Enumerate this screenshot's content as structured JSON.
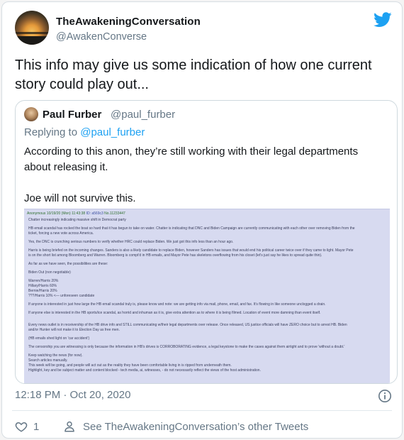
{
  "tweet": {
    "author_name": "TheAwakeningConversation",
    "author_handle": "@AwakenConverse",
    "text": "This info may give us some indication of how one current story could play out...",
    "timestamp": "12:18 PM · Oct 20, 2020",
    "like_count": "1",
    "see_other_tweets": "See TheAwakeningConversation’s other Tweets"
  },
  "quote": {
    "author_name": "Paul Furber",
    "author_handle": "@paul_furber",
    "replying_to_prefix": "Replying to ",
    "replying_to_handle": "@paul_furber",
    "body_p1": "According to this anon, they’re still working with their legal departments about releasing it.",
    "body_p2": "Joe will not survive this.",
    "image_header_name": "Anonymous",
    "image_header_date": "10/19/20 (Mon) 11:43:38",
    "image_header_id": "ID: a569c3",
    "image_header_no": "No.11233447",
    "image_lines": [
      "Chatter increasingly indicating massive shift in Democrat party",
      "",
      "HB email scandal has rocked the boat so hard that it has begun to take on water. Chatter is indicating that DNC and Biden Campaign are currently communicating with each other over removing Biden from the",
      "ticket, forcing a new vote across America.",
      "",
      "Yes, the DNC is crunching serious numbers to verify whether HRC could replace Biden. We just got this info less than an hour ago.",
      "",
      "Harris is being briefed on the incoming changes. Sanders is also a likely candidate to replace Biden, however Sanders has issues that would end his political career twice over if they came to light. Mayor Pete",
      "is on the short list among Bloomberg and Warren. Bloomberg is compt'd in HB emails, and Mayor Pete has skeletons overflowing from his closet (let's just say he likes to spread quite thin).",
      "",
      "As far as we have seen, the possibilities are these:",
      "",
      "Biden Out (non negotiable)",
      "",
      "Warren/Harris 20%",
      "Hillary/Harris 60%",
      "Bernie/Harris 20%",
      "???/Harris 10% <— unforeseen candidate",
      "",
      "If anyone is interested in just how large the HB email scandal truly is, please know and note: we are getting info via mail, phone, email, and fax. It's flowing in like someone unclogged a drain.",
      "",
      "If anyone else is interested in the HB sports/ice scandal, as horrid and inhuman as it is, give extra attention as to where it is being filmed. Location of event more damning than event itself.",
      "",
      "",
      "Every news outlet is in receivership of the HB drive info and STILL communicating w/their legal departments over release. Once released, US justice officials will have ZERO choice but to arrest HB. Biden",
      "and/or Hunter will not make it to Election Day as free men.",
      "",
      "(HB emails shed light on 'car accident')",
      "",
      "The censorship you are witnessing is only because the information in HB's drives is CORROBORATING evidence, a legal keystone to make the cases against them airtight and to prove 'without a doubt.'",
      "",
      "Keep watching the news (for now).",
      "Search articles manually.",
      "This week will be going, and people will act out as the reality they have been comfortable living in is ripped from underneath them.",
      "Highlight, key and be subject matter and content blocked - tech media, ai, witnesses, - do not necessarily reflect the views of the host administration."
    ]
  },
  "icons": {
    "brand": "twitter-bird-icon",
    "info": "info-icon",
    "heart": "heart-icon",
    "person": "person-icon"
  },
  "colors": {
    "accent": "#1da1f2",
    "muted": "#657786",
    "text": "#14171a"
  }
}
